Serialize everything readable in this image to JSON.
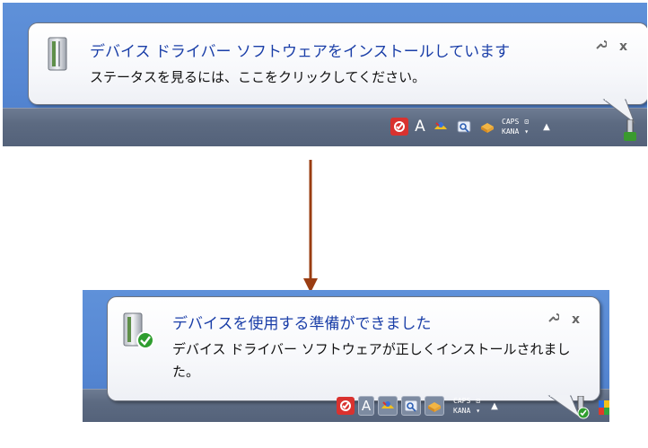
{
  "top": {
    "balloon": {
      "title": "デバイス ドライバー ソフトウェアをインストールしています",
      "body": "ステータスを見るには、ここをクリックしてください。",
      "options_icon": "wrench-icon",
      "close_label": "x"
    },
    "tray": {
      "caps_label": "CAPS",
      "kana_label": "KANA",
      "ime_letter": "A",
      "show_hidden_label": "▲"
    }
  },
  "bottom": {
    "balloon": {
      "title": "デバイスを使用する準備ができました",
      "body": "デバイス ドライバー ソフトウェアが正しくインストールされました。",
      "options_icon": "wrench-icon",
      "close_label": "x"
    },
    "tray": {
      "caps_label": "CAPS",
      "kana_label": "KANA",
      "ime_letter": "A",
      "show_hidden_label": "▲"
    }
  },
  "colors": {
    "title_blue": "#1a3ea8",
    "desktop_blue": "#5687d3",
    "taskbar_gray": "#5c6a81",
    "arrow_brown": "#9a3d12"
  }
}
